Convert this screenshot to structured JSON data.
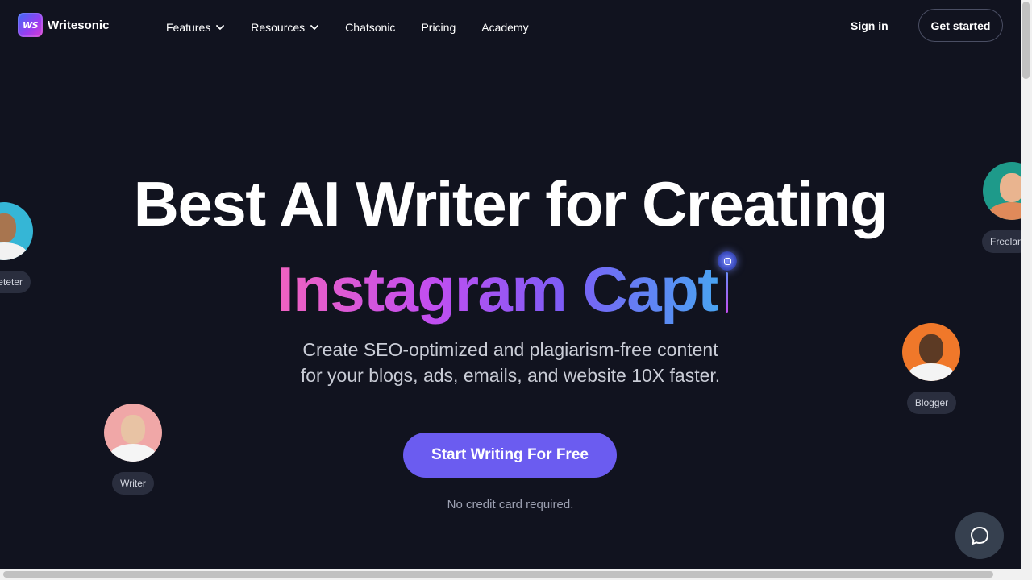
{
  "brand": {
    "logo_mark": "WS",
    "name": "Writesonic"
  },
  "nav": {
    "links": [
      {
        "label": "Features",
        "has_dropdown": true
      },
      {
        "label": "Resources",
        "has_dropdown": true
      },
      {
        "label": "Chatsonic",
        "has_dropdown": false
      },
      {
        "label": "Pricing",
        "has_dropdown": false
      },
      {
        "label": "Academy",
        "has_dropdown": false
      }
    ],
    "sign_in": "Sign in",
    "get_started": "Get started"
  },
  "hero": {
    "headline": "Best AI Writer for Creating",
    "typed_text": "Instagram Capt",
    "subtitle_line1": "Create SEO-optimized and plagiarism-free content",
    "subtitle_line2": "for your blogs, ads, emails, and website 10X faster.",
    "cta": "Start Writing For Free",
    "note": "No credit card required."
  },
  "personas": [
    {
      "role": "rketeter",
      "color": "#35b6d6"
    },
    {
      "role": "Freelan",
      "color": "#1e9a8a"
    },
    {
      "role": "Blogger",
      "color": "#f0782a"
    },
    {
      "role": "Writer",
      "color": "#f0a7a7"
    }
  ],
  "colors": {
    "background": "#11131f",
    "cta": "#6b5cf0",
    "gradient": [
      "#f062c0",
      "#c24ef0",
      "#7d5cf6",
      "#4aa3f2"
    ]
  },
  "icons": {
    "chat": "chat-bubble-icon",
    "chevron": "chevron-down-icon"
  }
}
